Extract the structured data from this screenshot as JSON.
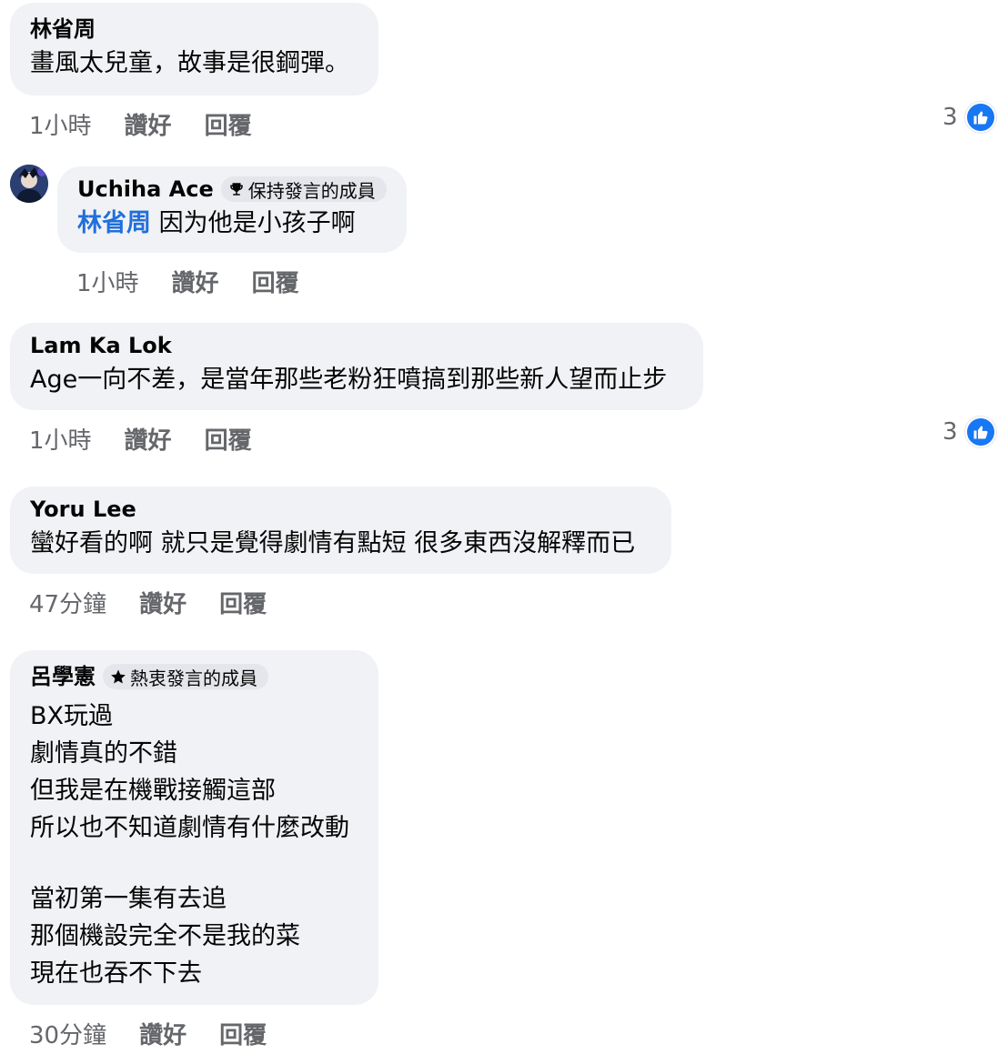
{
  "comments": [
    {
      "author": "林省周",
      "lines": [
        "畫風太兒童，故事是很鋼彈。"
      ],
      "time": "1小時",
      "like": "讚好",
      "reply": "回覆",
      "reaction_count": "3"
    },
    {
      "author": "Uchiha Ace",
      "badge": "保持發言的成員",
      "mention": "林省周",
      "text_after_mention": " 因为他是小孩子啊",
      "time": "1小時",
      "like": "讚好",
      "reply": "回覆"
    },
    {
      "author": "Lam Ka Lok",
      "lines": [
        "Age一向不差，是當年那些老粉狂噴搞到那些新人望而止步"
      ],
      "time": "1小時",
      "like": "讚好",
      "reply": "回覆",
      "reaction_count": "3"
    },
    {
      "author": "Yoru Lee",
      "lines": [
        "蠻好看的啊 就只是覺得劇情有點短 很多東西沒解釋而已"
      ],
      "time": "47分鐘",
      "like": "讚好",
      "reply": "回覆"
    },
    {
      "author": "呂學憲",
      "badge": "熱衷發言的成員",
      "lines": [
        "BX玩過",
        "劇情真的不錯",
        "但我是在機戰接觸這部",
        "所以也不知道劇情有什麼改動",
        "",
        "當初第一集有去追",
        "那個機設完全不是我的菜",
        "現在也吞不下去"
      ],
      "time": "30分鐘",
      "like": "讚好",
      "reply": "回覆"
    }
  ],
  "colors": {
    "bubble": "#f0f2f5",
    "badge": "#e4e6eb",
    "mention": "#216fdb",
    "meta": "#65676b",
    "like_blue": "#1877f2"
  }
}
